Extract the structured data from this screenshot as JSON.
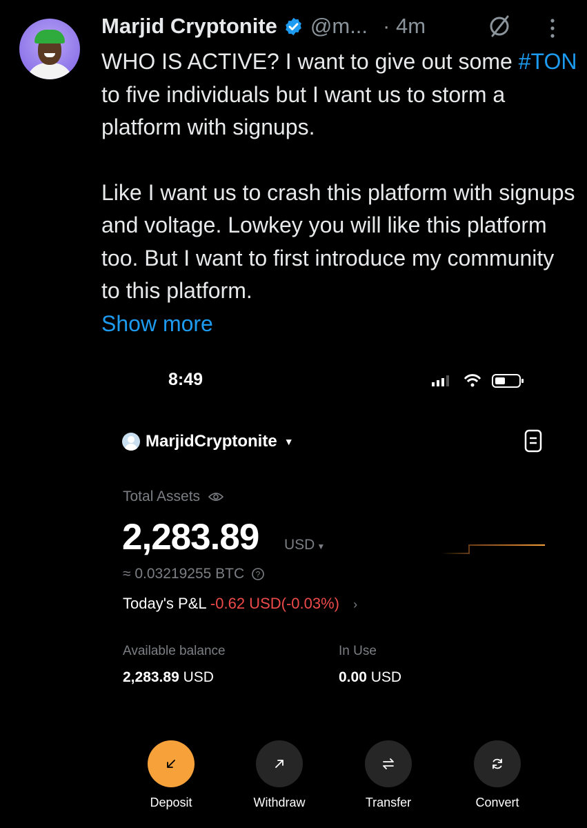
{
  "tweet": {
    "author_name": "Marjid Cryptonite",
    "handle": "@m...",
    "time": "· 4m",
    "paragraph1_before": "WHO IS ACTIVE? I want to give out some",
    "hashtag": "#TON",
    "paragraph1_after": " to five individuals but I want us to storm a platform with signups.",
    "paragraph2": "Like I want us to crash this platform with signups and voltage. Lowkey you will like this platform too. But I want to first introduce my community to this platform.",
    "show_more": "Show more",
    "icons": [
      "verified-badge-icon",
      "grok-icon",
      "more-options-icon"
    ]
  },
  "phone": {
    "clock": "8:49",
    "account": "MarjidCryptonite",
    "total_assets_label": "Total Assets",
    "total_value": "2,283.89",
    "total_unit": "USD",
    "btc_value": "≈ 0.03219255 BTC",
    "pnl_label": "Today's P&L",
    "pnl_value": "-0.62 USD(-0.03%)",
    "available_label": "Available balance",
    "available_value": "2,283.89",
    "available_unit": "USD",
    "inuse_label": "In Use",
    "inuse_value": "0.00",
    "inuse_unit": "USD",
    "actions": [
      {
        "label": "Deposit",
        "icon": "arrow-down-left-icon"
      },
      {
        "label": "Withdraw",
        "icon": "arrow-up-right-icon"
      },
      {
        "label": "Transfer",
        "icon": "swap-arrows-icon"
      },
      {
        "label": "Convert",
        "icon": "refresh-icon"
      }
    ]
  },
  "colors": {
    "accent": "#1d9bf0",
    "deposit": "#f7a13a",
    "negative": "#ef4a4a",
    "muted": "#7b7f84"
  }
}
